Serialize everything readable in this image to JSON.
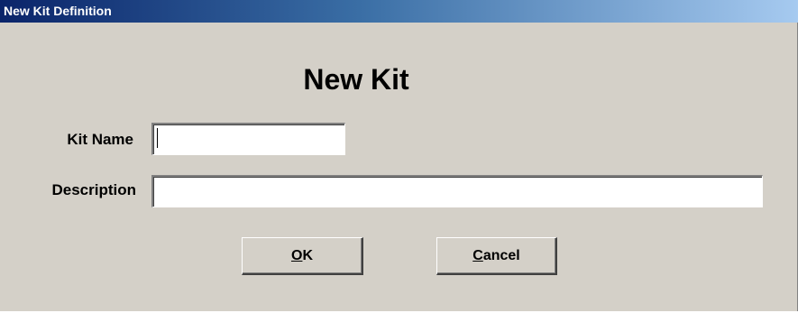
{
  "window": {
    "title": "New Kit Definition"
  },
  "form": {
    "heading": "New Kit",
    "kit_name_label": "Kit Name",
    "kit_name_value": "",
    "description_label": "Description",
    "description_value": ""
  },
  "buttons": {
    "ok_label": "OK",
    "ok_mnemonic": "O",
    "cancel_label": "Cancel",
    "cancel_mnemonic": "C"
  },
  "colors": {
    "window_bg": "#d4d0c8",
    "titlebar_start": "#0a246a",
    "titlebar_end": "#a6caf0",
    "title_text": "#ffffff"
  }
}
